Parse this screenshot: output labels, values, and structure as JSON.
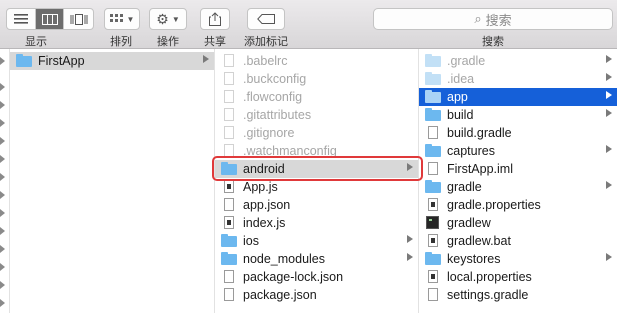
{
  "toolbar": {
    "view_label": "显示",
    "arrange_label": "排列",
    "action_label": "操作",
    "share_label": "共享",
    "tags_label": "添加标记",
    "search_placeholder": "搜索",
    "search_label": "搜索",
    "active_view": "column-view"
  },
  "columns": {
    "col1": [
      {
        "name": "FirstApp",
        "kind": "folder",
        "selected": "grey",
        "arrow": true
      }
    ],
    "col2": [
      {
        "name": ".babelrc",
        "kind": "file",
        "dim": true
      },
      {
        "name": ".buckconfig",
        "kind": "file",
        "dim": true
      },
      {
        "name": ".flowconfig",
        "kind": "file",
        "dim": true
      },
      {
        "name": ".gitattributes",
        "kind": "file",
        "dim": true
      },
      {
        "name": ".gitignore",
        "kind": "file",
        "dim": true
      },
      {
        "name": ".watchmanconfig",
        "kind": "file",
        "dim": true
      },
      {
        "name": "android",
        "kind": "folder",
        "selected": "grey",
        "arrow": true
      },
      {
        "name": "App.js",
        "kind": "js"
      },
      {
        "name": "app.json",
        "kind": "file"
      },
      {
        "name": "index.js",
        "kind": "js"
      },
      {
        "name": "ios",
        "kind": "folder",
        "arrow": true
      },
      {
        "name": "node_modules",
        "kind": "folder",
        "arrow": true
      },
      {
        "name": "package-lock.json",
        "kind": "file"
      },
      {
        "name": "package.json",
        "kind": "file"
      }
    ],
    "col3": [
      {
        "name": ".gradle",
        "kind": "folder",
        "dim": true,
        "arrow": true
      },
      {
        "name": ".idea",
        "kind": "folder",
        "dim": true,
        "arrow": true
      },
      {
        "name": "app",
        "kind": "folder",
        "selected": "blue",
        "arrow": true
      },
      {
        "name": "build",
        "kind": "folder",
        "arrow": true
      },
      {
        "name": "build.gradle",
        "kind": "file"
      },
      {
        "name": "captures",
        "kind": "folder",
        "arrow": true
      },
      {
        "name": "FirstApp.iml",
        "kind": "file"
      },
      {
        "name": "gradle",
        "kind": "folder",
        "arrow": true
      },
      {
        "name": "gradle.properties",
        "kind": "js"
      },
      {
        "name": "gradlew",
        "kind": "exec"
      },
      {
        "name": "gradlew.bat",
        "kind": "js"
      },
      {
        "name": "keystores",
        "kind": "folder",
        "arrow": true
      },
      {
        "name": "local.properties",
        "kind": "js"
      },
      {
        "name": "settings.gradle",
        "kind": "file"
      }
    ]
  },
  "annotation": {
    "highlighted_item": "android",
    "color": "#e0393a"
  }
}
